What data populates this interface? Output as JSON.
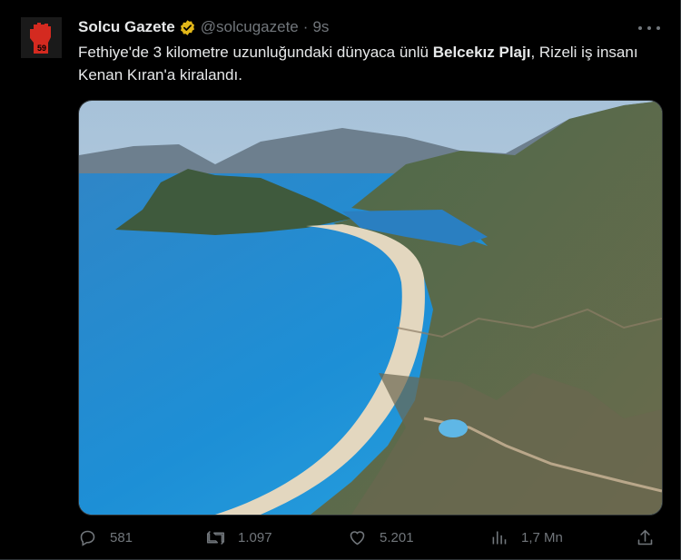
{
  "author": {
    "name": "Solcu Gazete",
    "handle": "@solcugazete",
    "separator": "·",
    "time": "9s",
    "avatar_mark": "59"
  },
  "tweet": {
    "text_before": "Fethiye'de 3 kilometre uzunluğundaki dünyaca ünlü ",
    "text_bold": "Belcekız Plajı",
    "text_after": ", Rizeli iş insanı Kenan Kıran'a kiralandı."
  },
  "actions": {
    "replies": "581",
    "reposts": "1.097",
    "likes": "5.201",
    "views": "1,7 Mn"
  },
  "colors": {
    "background": "#000000",
    "text": "#e7e9ea",
    "muted": "#71767b",
    "verified_gold": "#e2b719",
    "avatar_red": "#d42a20"
  },
  "icons": [
    "verified-badge-icon",
    "more-icon",
    "reply-icon",
    "repost-icon",
    "like-icon",
    "views-icon",
    "share-icon"
  ]
}
